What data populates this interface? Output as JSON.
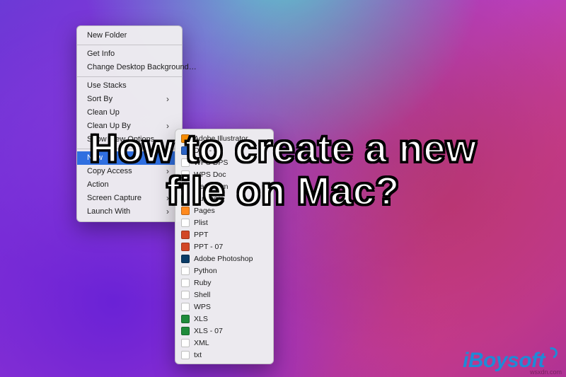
{
  "context_menu": {
    "groups": [
      [
        {
          "label": "New Folder",
          "submenu": false
        }
      ],
      [
        {
          "label": "Get Info",
          "submenu": false
        },
        {
          "label": "Change Desktop Background…",
          "submenu": false
        }
      ],
      [
        {
          "label": "Use Stacks",
          "submenu": false
        },
        {
          "label": "Sort By",
          "submenu": true
        },
        {
          "label": "Clean Up",
          "submenu": false
        },
        {
          "label": "Clean Up By",
          "submenu": true
        },
        {
          "label": "Show View Options",
          "submenu": false
        }
      ],
      [
        {
          "label": "New",
          "submenu": true,
          "selected": true
        },
        {
          "label": "Copy Access",
          "submenu": true
        },
        {
          "label": "Action",
          "submenu": true
        },
        {
          "label": "Screen Capture",
          "submenu": true
        },
        {
          "label": "Launch With",
          "submenu": true
        }
      ]
    ]
  },
  "submenu": {
    "title": "New",
    "items": [
      {
        "label": "Adobe Illustrator",
        "icon_color": "#f58b00"
      },
      {
        "label": "Doc - 07",
        "icon_color": "#2a63c4"
      },
      {
        "label": "WPS DPS",
        "icon_color": "#ffffff"
      },
      {
        "label": "WPS Doc",
        "icon_color": "#ffffff"
      },
      {
        "label": "Markdown",
        "icon_color": "#2d2d2d"
      },
      {
        "label": "Numbers",
        "icon_color": "#32c46b"
      },
      {
        "label": "Pages",
        "icon_color": "#ff8a1e"
      },
      {
        "label": "Plist",
        "icon_color": "#ffffff"
      },
      {
        "label": "PPT",
        "icon_color": "#d24726"
      },
      {
        "label": "PPT - 07",
        "icon_color": "#d24726"
      },
      {
        "label": "Adobe Photoshop",
        "icon_color": "#0a3b66"
      },
      {
        "label": "Python",
        "icon_color": "#ffffff"
      },
      {
        "label": "Ruby",
        "icon_color": "#ffffff"
      },
      {
        "label": "Shell",
        "icon_color": "#ffffff"
      },
      {
        "label": "WPS",
        "icon_color": "#ffffff"
      },
      {
        "label": "XLS",
        "icon_color": "#1f8b3b"
      },
      {
        "label": "XLS - 07",
        "icon_color": "#1f8b3b"
      },
      {
        "label": "XML",
        "icon_color": "#ffffff"
      },
      {
        "label": "txt",
        "icon_color": "#ffffff"
      }
    ]
  },
  "headline": {
    "line1": "How to create a new",
    "line2": "file on Mac?"
  },
  "watermark": "iBoysoft",
  "source_tag": "wsxdn.com"
}
